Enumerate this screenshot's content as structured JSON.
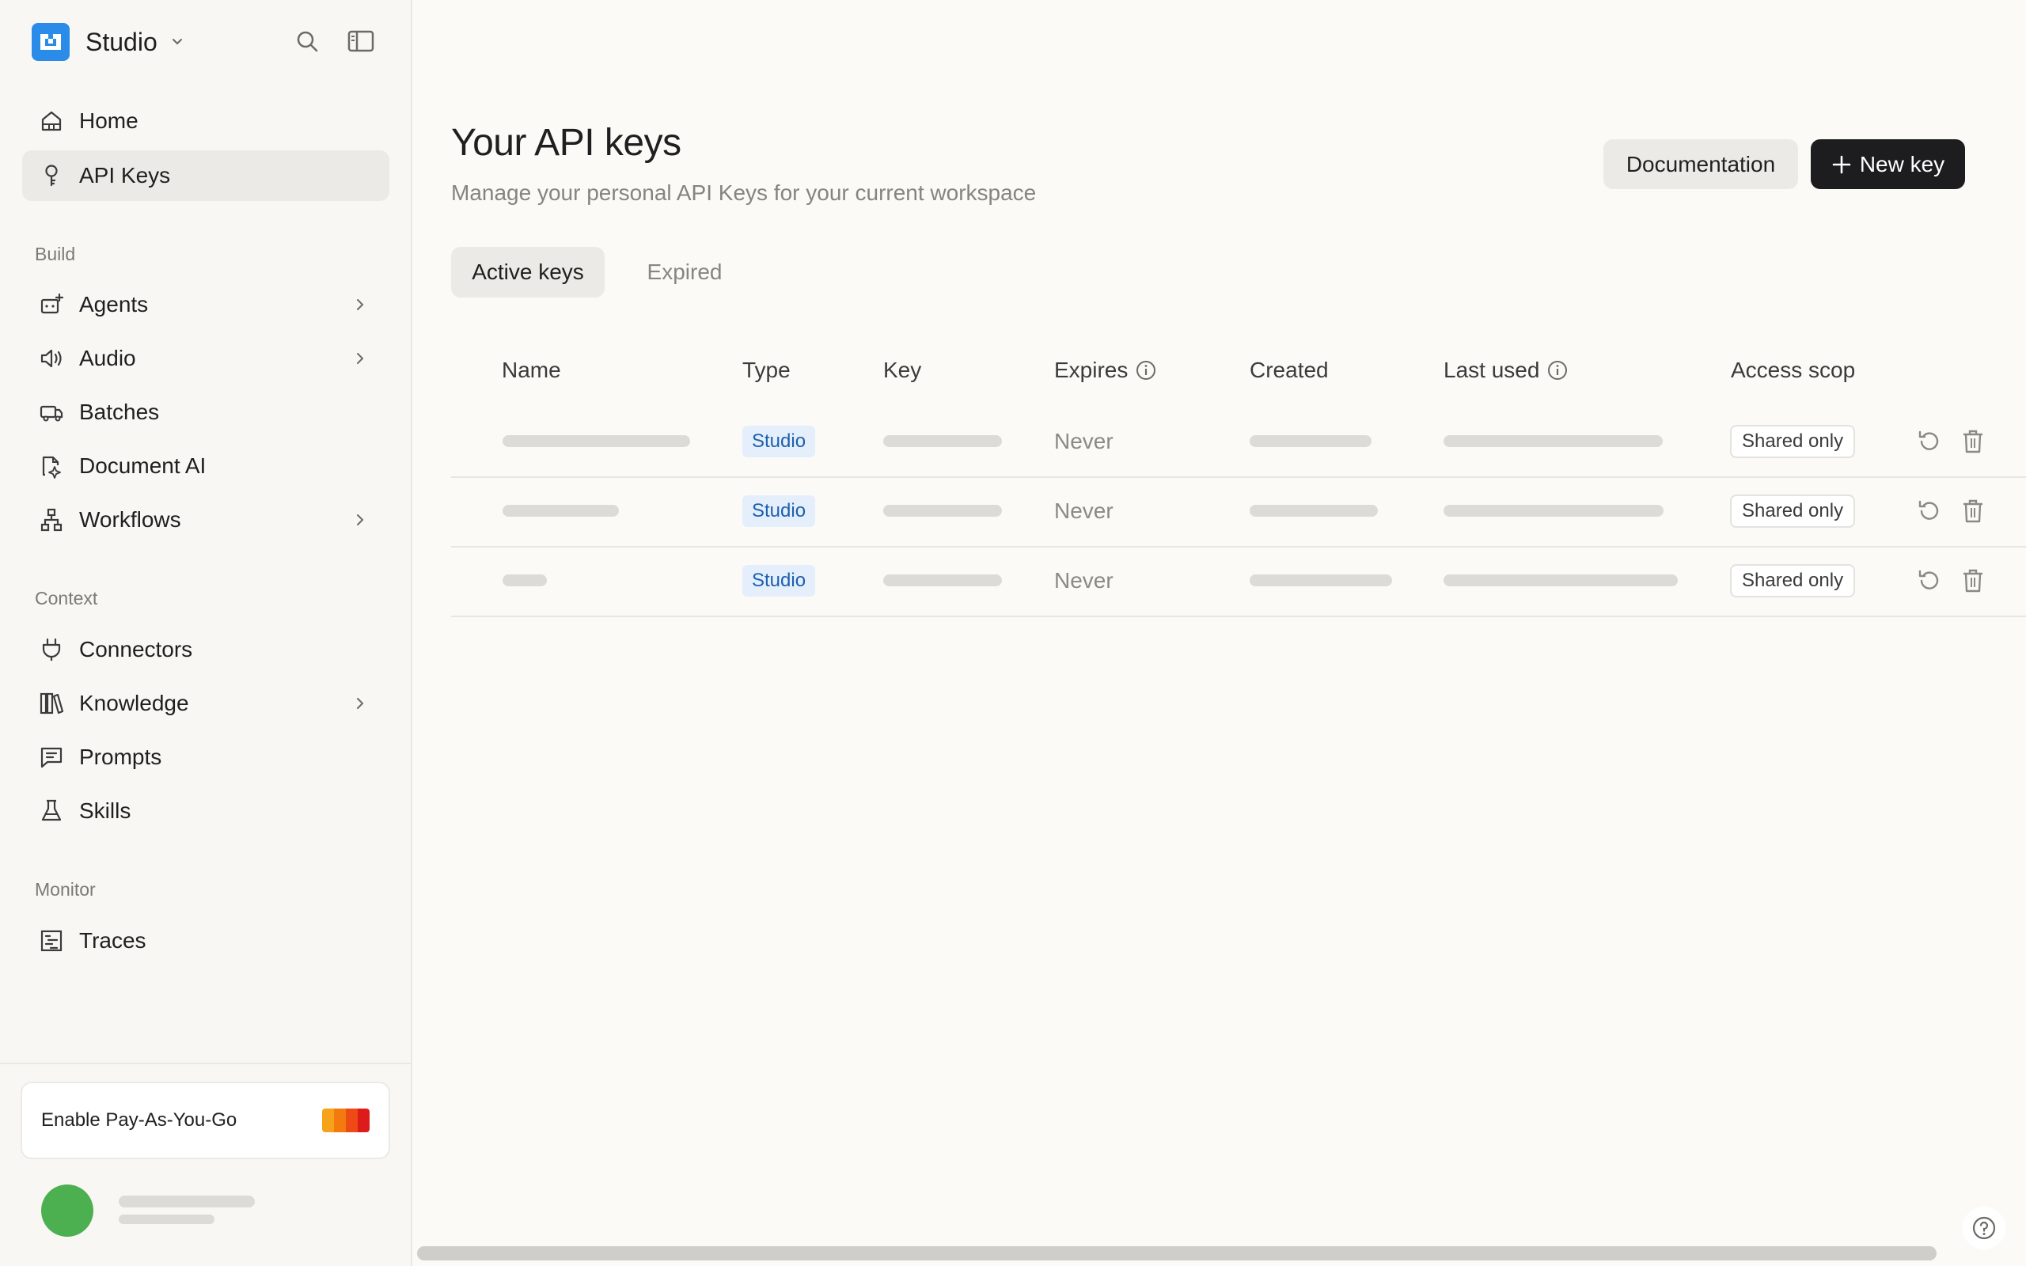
{
  "sidebar": {
    "brand": {
      "name": "Studio",
      "logo_color": "#2b8be8"
    },
    "top_items": [
      {
        "label": "Home",
        "icon": "home-icon"
      },
      {
        "label": "API Keys",
        "icon": "key-icon",
        "active": true
      }
    ],
    "sections": {
      "build": {
        "label": "Build",
        "items": [
          {
            "label": "Agents",
            "icon": "agent-icon",
            "has_children": true
          },
          {
            "label": "Audio",
            "icon": "speaker-icon",
            "has_children": true
          },
          {
            "label": "Batches",
            "icon": "batches-icon",
            "has_children": false
          },
          {
            "label": "Document AI",
            "icon": "document-ai-icon",
            "has_children": false
          },
          {
            "label": "Workflows",
            "icon": "workflow-icon",
            "has_children": true
          }
        ]
      },
      "context": {
        "label": "Context",
        "items": [
          {
            "label": "Connectors",
            "icon": "plug-icon",
            "has_children": false
          },
          {
            "label": "Knowledge",
            "icon": "library-icon",
            "has_children": true
          },
          {
            "label": "Prompts",
            "icon": "message-square-icon",
            "has_children": false
          },
          {
            "label": "Skills",
            "icon": "flask-icon",
            "has_children": false
          }
        ]
      },
      "monitor": {
        "label": "Monitor",
        "items": [
          {
            "label": "Traces",
            "icon": "traces-icon",
            "has_children": false
          }
        ]
      }
    },
    "payg": {
      "label": "Enable Pay-As-You-Go",
      "bar_colors": [
        "#f6a21a",
        "#f27a0f",
        "#ee4a16",
        "#dd1b1b"
      ]
    },
    "user": {
      "avatar_color": "#4caf50"
    }
  },
  "main": {
    "title": "Your API keys",
    "subtitle": "Manage your personal API Keys for your current workspace",
    "buttons": {
      "documentation": "Documentation",
      "new_key": "New key"
    },
    "tabs": [
      {
        "label": "Active keys",
        "active": true
      },
      {
        "label": "Expired",
        "active": false
      }
    ],
    "table": {
      "columns": [
        "Name",
        "Type",
        "Key",
        "Expires",
        "Created",
        "Last used",
        "Access scop"
      ],
      "rows": [
        {
          "type": "Studio",
          "expires": "Never",
          "scope": "Shared only"
        },
        {
          "type": "Studio",
          "expires": "Never",
          "scope": "Shared only"
        },
        {
          "type": "Studio",
          "expires": "Never",
          "scope": "Shared only"
        }
      ]
    }
  },
  "colors": {
    "accent_dark": "#1d1d1f",
    "badge_blue": "#1d5fb0",
    "background": "#fbfaf7"
  }
}
